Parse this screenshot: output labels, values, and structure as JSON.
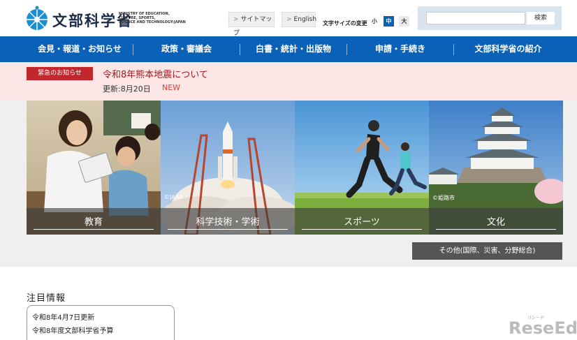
{
  "header": {
    "logo_jp": "文部科学省",
    "logo_en": "MINISTRY OF EDUCATION,\nCULTURE, SPORTS,\nSCIENCE AND TECHNOLOGY-JAPAN",
    "sitemap_label": "サイトマップ",
    "english_label": "English",
    "font_size_label": "文字サイズの変更",
    "font_sizes": [
      "小",
      "中",
      "大"
    ],
    "search_placeholder": "",
    "search_button": "検索"
  },
  "nav": {
    "items": [
      {
        "label": "会見・報道・お知らせ"
      },
      {
        "label": "政策・審議会"
      },
      {
        "label": "白書・統計・出版物"
      },
      {
        "label": "申請・手続き"
      },
      {
        "label": "文部科学省の紹介"
      }
    ]
  },
  "emergency": {
    "badge": "緊急のお知らせ",
    "title": "令和8年熊本地震について",
    "updated": "更新:8月20日",
    "new_label": "NEW"
  },
  "hero": {
    "tiles": [
      {
        "label": "教育",
        "credit": ""
      },
      {
        "label": "科学技術・学術",
        "credit": "©JAXA"
      },
      {
        "label": "スポーツ",
        "credit": ""
      },
      {
        "label": "文化",
        "credit": "©姫路市"
      }
    ],
    "other_button": "その他(国際、災害、分野総合)"
  },
  "attention": {
    "title": "注目情報",
    "lines": [
      "令和8年4月7日更新",
      "令和8年度文部科学省予算"
    ]
  },
  "watermark": {
    "small": "リシード",
    "text": "ReseEd"
  },
  "colors": {
    "nav_blue": "#0a62b8",
    "emergency_bg": "#fce6e6",
    "emergency_red": "#c1272d",
    "new_red": "#e03a3a"
  }
}
